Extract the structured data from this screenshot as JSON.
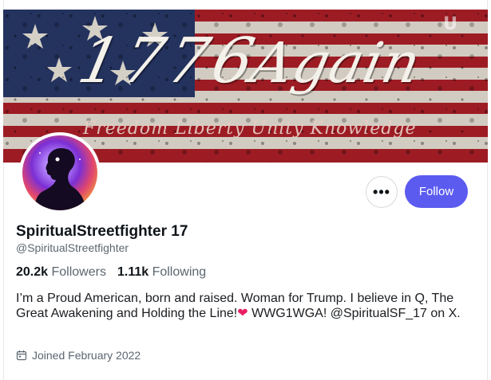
{
  "banner": {
    "title_number": "1776",
    "title_word": "Again",
    "subtitle": "Freedom  Liberty  Unity  Knowledge",
    "mark": "U"
  },
  "profile": {
    "display_name": "SpiritualStreetfighter 17",
    "handle": "@SpiritualStreetfighter",
    "followers_count": "20.2k",
    "followers_label": "Followers",
    "following_count": "1.11k",
    "following_label": "Following",
    "bio_part1": "I’m a Proud American, born and raised. Woman for Trump. I believe in Q, The Great Awakening and Holding the Line!",
    "bio_heart": "❤",
    "bio_part2": " WWG1WGA! @SpiritualSF_17 on X.",
    "joined": "Joined February 2022"
  },
  "actions": {
    "more_label": "•••",
    "follow_label": "Follow"
  },
  "colors": {
    "accent": "#5b5bf0",
    "flag_red": "#b3202a",
    "flag_blue": "#2a3a6b",
    "heart": "#e91e63"
  }
}
